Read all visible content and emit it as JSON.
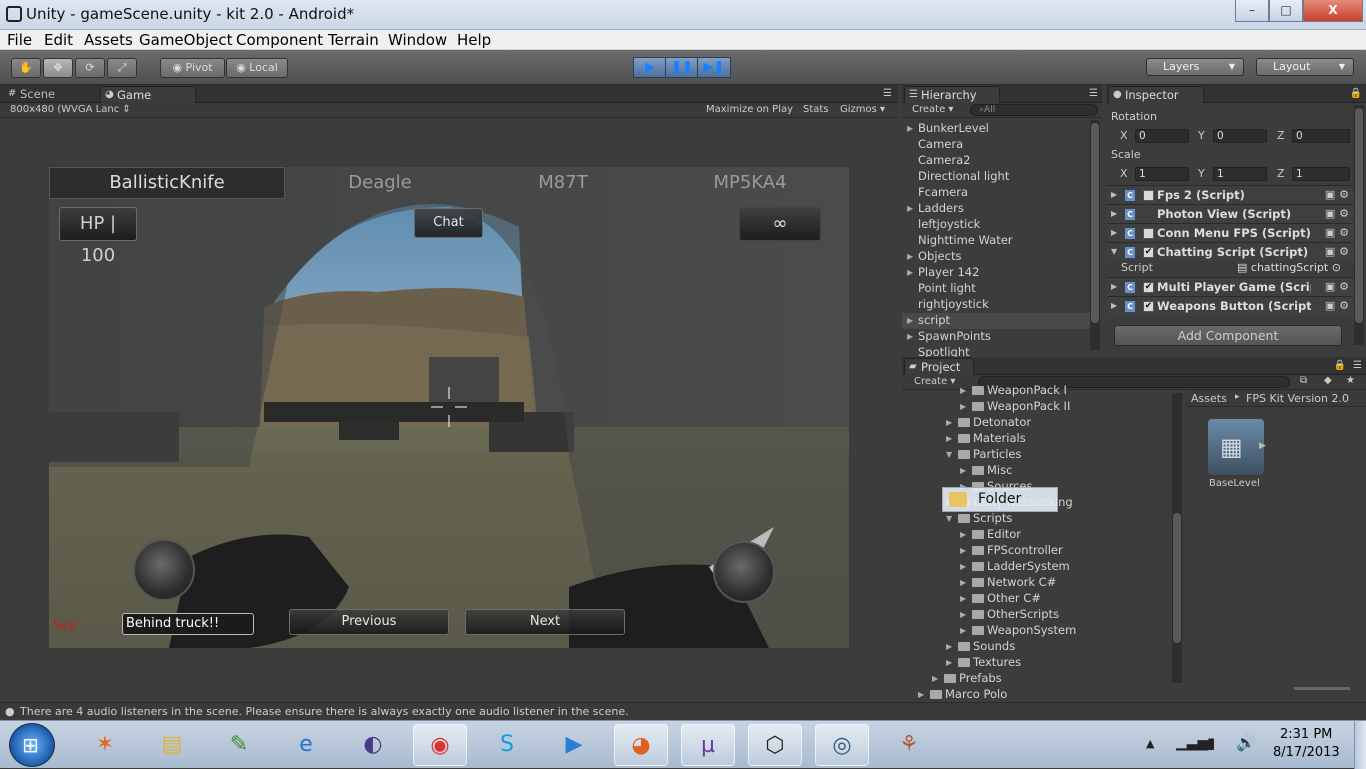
{
  "window": {
    "title": "Unity - gameScene.unity - kit 2.0 - Android*",
    "minimize": "–",
    "maximize": "□",
    "close": "X"
  },
  "menu": [
    "File",
    "Edit",
    "Assets",
    "GameObject",
    "Component",
    "Terrain",
    "Window",
    "Help"
  ],
  "toolbar": {
    "pivot": "Pivot",
    "local": "Local",
    "play": "▶",
    "pause": "❚❚",
    "step": "▶❚",
    "layers": "Layers",
    "layout": "Layout"
  },
  "scene_tabs": {
    "scene": "Scene",
    "game": "Game",
    "resolution": "800x480 (WVGA Lanc",
    "maximize_on_play": "Maximize on Play",
    "stats": "Stats",
    "gizmos": "Gizmos"
  },
  "game": {
    "weapons": [
      "BallisticKnife",
      "Deagle",
      "M87T",
      "MP5KA4"
    ],
    "hp": "HP | 100",
    "chat_button": "Chat",
    "ammo": "∞",
    "say_label": "Say:",
    "chat_input": "Behind truck!!",
    "previous": "Previous",
    "next": "Next"
  },
  "hierarchy": {
    "title": "Hierarchy",
    "create": "Create",
    "search_placeholder": "All",
    "items": [
      {
        "label": "BunkerLevel",
        "expandable": true
      },
      {
        "label": "Camera",
        "expandable": false
      },
      {
        "label": "Camera2",
        "expandable": false
      },
      {
        "label": "Directional light",
        "expandable": false
      },
      {
        "label": "Fcamera",
        "expandable": false
      },
      {
        "label": "Ladders",
        "expandable": true
      },
      {
        "label": "leftjoystick",
        "expandable": false
      },
      {
        "label": "Nighttime Water",
        "expandable": false
      },
      {
        "label": "Objects",
        "expandable": true
      },
      {
        "label": "Player 142",
        "expandable": true
      },
      {
        "label": "Point light",
        "expandable": false
      },
      {
        "label": "rightjoystick",
        "expandable": false
      },
      {
        "label": "script",
        "expandable": true
      },
      {
        "label": "SpawnPoints",
        "expandable": true
      },
      {
        "label": "Spotlight",
        "expandable": false
      }
    ]
  },
  "inspector": {
    "title": "Inspector",
    "rotation_label": "Rotation",
    "scale_label": "Scale",
    "rotation": {
      "x": "0",
      "y": "0",
      "z": "0"
    },
    "scale": {
      "x": "1",
      "y": "1",
      "z": "1"
    },
    "components": [
      {
        "name": "Fps 2 (Script)",
        "checked": false
      },
      {
        "name": "Photon View (Script)",
        "checked": null
      },
      {
        "name": "Conn Menu FPS (Script)",
        "checked": false
      },
      {
        "name": "Chatting Script (Script)",
        "checked": true
      },
      {
        "name": "Multi Player Game (Script)",
        "checked": true
      },
      {
        "name": "Weapons Button (Script)",
        "checked": true
      }
    ],
    "script_label": "Script",
    "script_value": "chattingScript",
    "add_component": "Add Component"
  },
  "project": {
    "title": "Project",
    "create": "Create",
    "tree": [
      {
        "label": "WeaponPack I",
        "indent": 2
      },
      {
        "label": "WeaponPack II",
        "indent": 2
      },
      {
        "label": "Detonator",
        "indent": 1
      },
      {
        "label": "Materials",
        "indent": 1
      },
      {
        "label": "Particles",
        "indent": 1
      },
      {
        "label": "Misc",
        "indent": 2
      },
      {
        "label": "Sources",
        "indent": 2
      },
      {
        "label": "Unity Networking",
        "indent": 1
      },
      {
        "label": "Scripts",
        "indent": 1
      },
      {
        "label": "Editor",
        "indent": 2
      },
      {
        "label": "FPScontroller",
        "indent": 2
      },
      {
        "label": "LadderSystem",
        "indent": 2
      },
      {
        "label": "Network C#",
        "indent": 2
      },
      {
        "label": "Other C#",
        "indent": 2
      },
      {
        "label": "OtherScripts",
        "indent": 2
      },
      {
        "label": "WeaponSystem",
        "indent": 2
      },
      {
        "label": "Sounds",
        "indent": 1
      },
      {
        "label": "Textures",
        "indent": 1
      },
      {
        "label": "Prefabs",
        "indent": 0
      },
      {
        "label": "Marco Polo",
        "indent": -1
      }
    ],
    "drag_tooltip": "Folder",
    "breadcrumb": [
      "Assets",
      "FPS Kit Version 2.0"
    ],
    "asset_label": "BaseLevel"
  },
  "status": {
    "message": "There are 4 audio listeners in the scene. Please ensure there is always exactly one audio listener in the scene."
  },
  "taskbar": {
    "apps": [
      "paint-icon",
      "explorer-icon",
      "notepad-icon",
      "ie-icon",
      "eclipse-icon",
      "chrome-icon",
      "skype-icon",
      "media-player-icon",
      "firefox-icon",
      "bittorrent-icon",
      "unity-icon",
      "monodevelop-icon",
      "paint-palette-icon"
    ],
    "time": "2:31 PM",
    "date": "8/17/2013"
  }
}
